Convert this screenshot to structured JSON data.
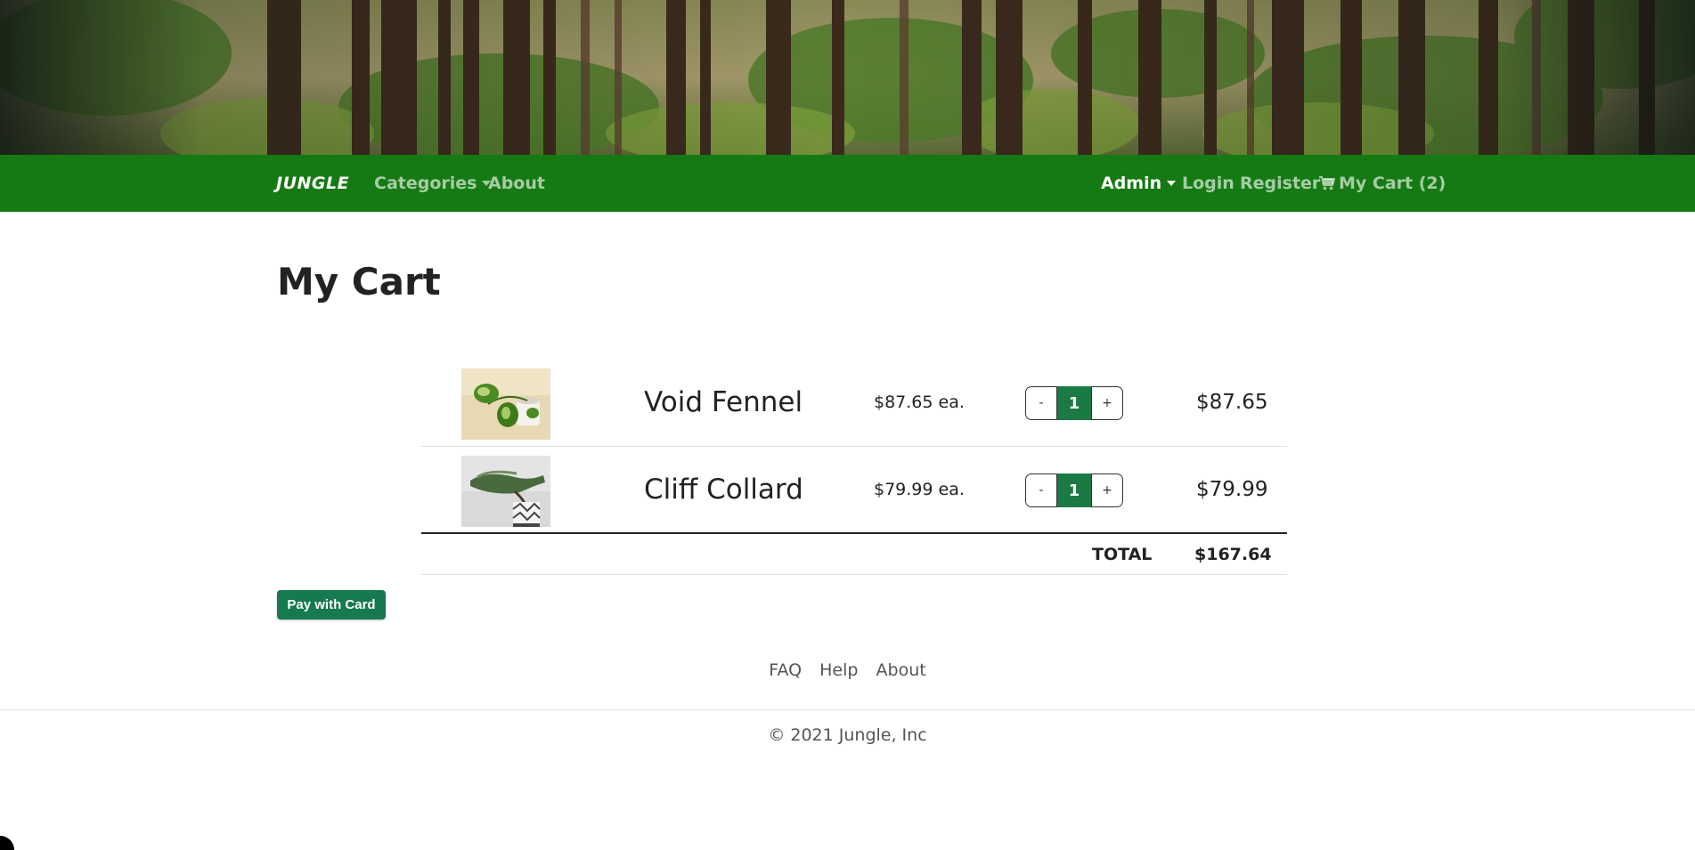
{
  "header": {
    "banner_image": "forest-banner-image"
  },
  "navbar": {
    "brand": "JUNGLE",
    "left_links": [
      {
        "label": "Categories",
        "dropdown": true
      },
      {
        "label": "About",
        "dropdown": false
      }
    ],
    "right_links": [
      {
        "label": "Admin",
        "dropdown": true
      },
      {
        "label": "Login",
        "dropdown": false
      },
      {
        "label": "Register",
        "dropdown": false
      },
      {
        "label": "My Cart (2)",
        "icon": "cart-icon"
      }
    ],
    "colors": {
      "background": "#157a13",
      "link": "#a8cfa6",
      "active": "#ffffff"
    }
  },
  "main": {
    "title": "My Cart",
    "items": [
      {
        "image": "pothos-plant-image",
        "name": "Void Fennel",
        "unit_price": "$87.65 ea.",
        "quantity": "1",
        "line_total": "$87.65"
      },
      {
        "image": "bonsai-juniper-image",
        "name": "Cliff Collard",
        "unit_price": "$79.99 ea.",
        "quantity": "1",
        "line_total": "$79.99"
      }
    ],
    "qty_minus": "-",
    "qty_plus": "+",
    "total_label": "TOTAL",
    "total_value": "$167.64",
    "pay_button": "Pay with Card",
    "colors": {
      "qty_badge": "#1b7a43",
      "pay_button": "#167a4e"
    }
  },
  "footer": {
    "links": [
      "FAQ",
      "Help",
      "About"
    ],
    "copyright": "© 2021 Jungle, Inc"
  }
}
